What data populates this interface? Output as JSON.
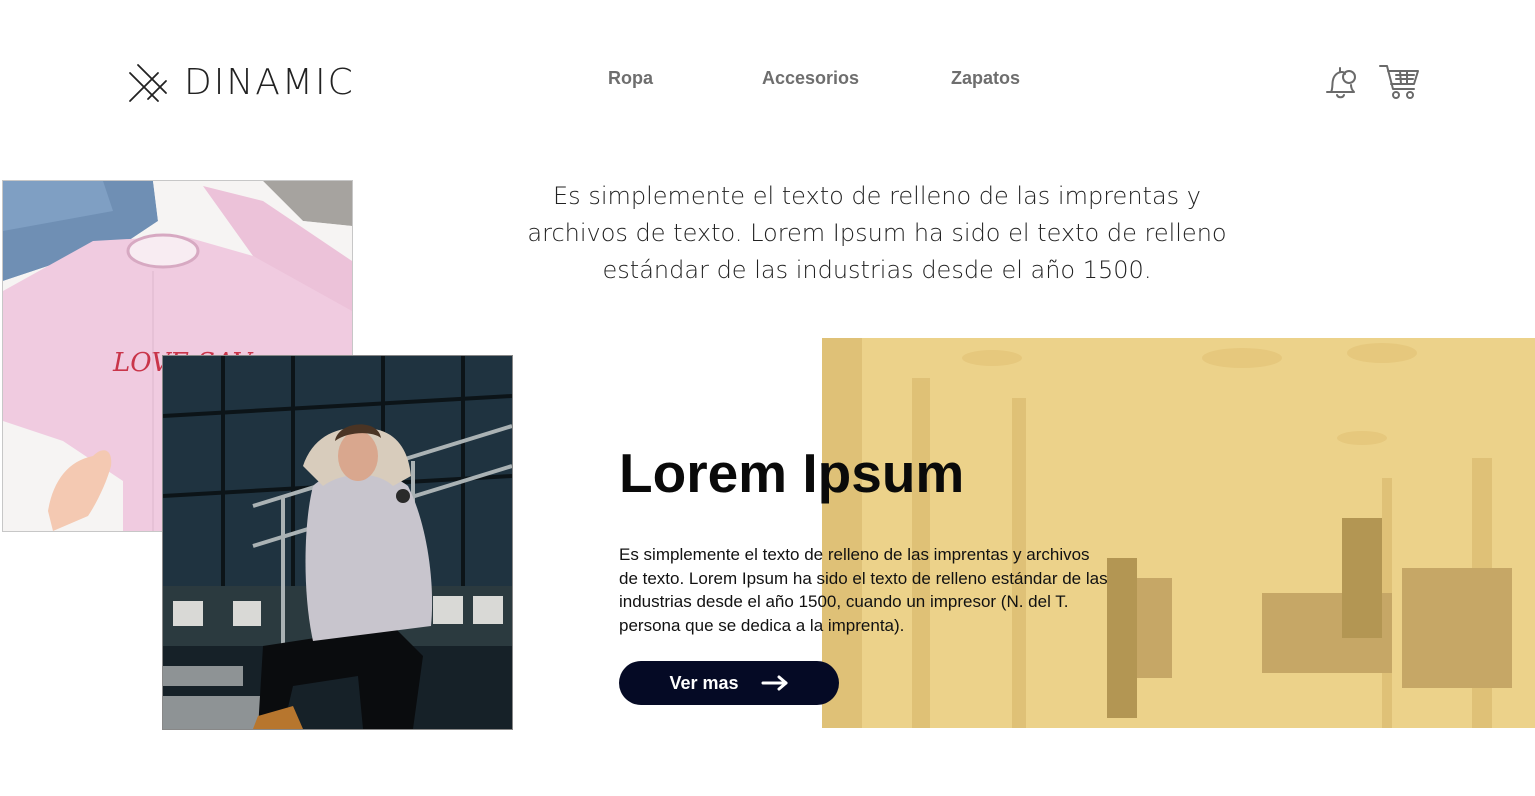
{
  "brand": {
    "name": "DINAMIC"
  },
  "nav": {
    "items": [
      "Ropa",
      "Accesorios",
      "Zapatos"
    ]
  },
  "header_icons": {
    "notifications": "bell-icon",
    "cart": "shopping-cart-icon"
  },
  "intro": {
    "text": "Es simplemente el texto de relleno de las imprentas y archivos de texto. Lorem Ipsum ha sido el texto de relleno estándar de las industrias desde el año 1500."
  },
  "hero": {
    "title": "Lorem Ipsum",
    "body": "Es simplemente el texto de relleno de las imprentas y archivos de texto. Lorem Ipsum ha sido el texto de relleno estándar de las industrias desde el año 1500, cuando un impresor (N. del T. persona que se dedica a la imprenta).",
    "cta_label": "Ver mas",
    "cta_icon": "arrow-right-icon"
  },
  "images": {
    "shirt_print": "LOVE SAV",
    "shirt_photo": "pink-shirt-photo",
    "man_photo": "man-in-parka-photo",
    "store_photo": "clothing-store-photo"
  },
  "colors": {
    "accent": "#050a25",
    "overlay": "#ecd28a",
    "nav_text": "#6e6e6e"
  }
}
